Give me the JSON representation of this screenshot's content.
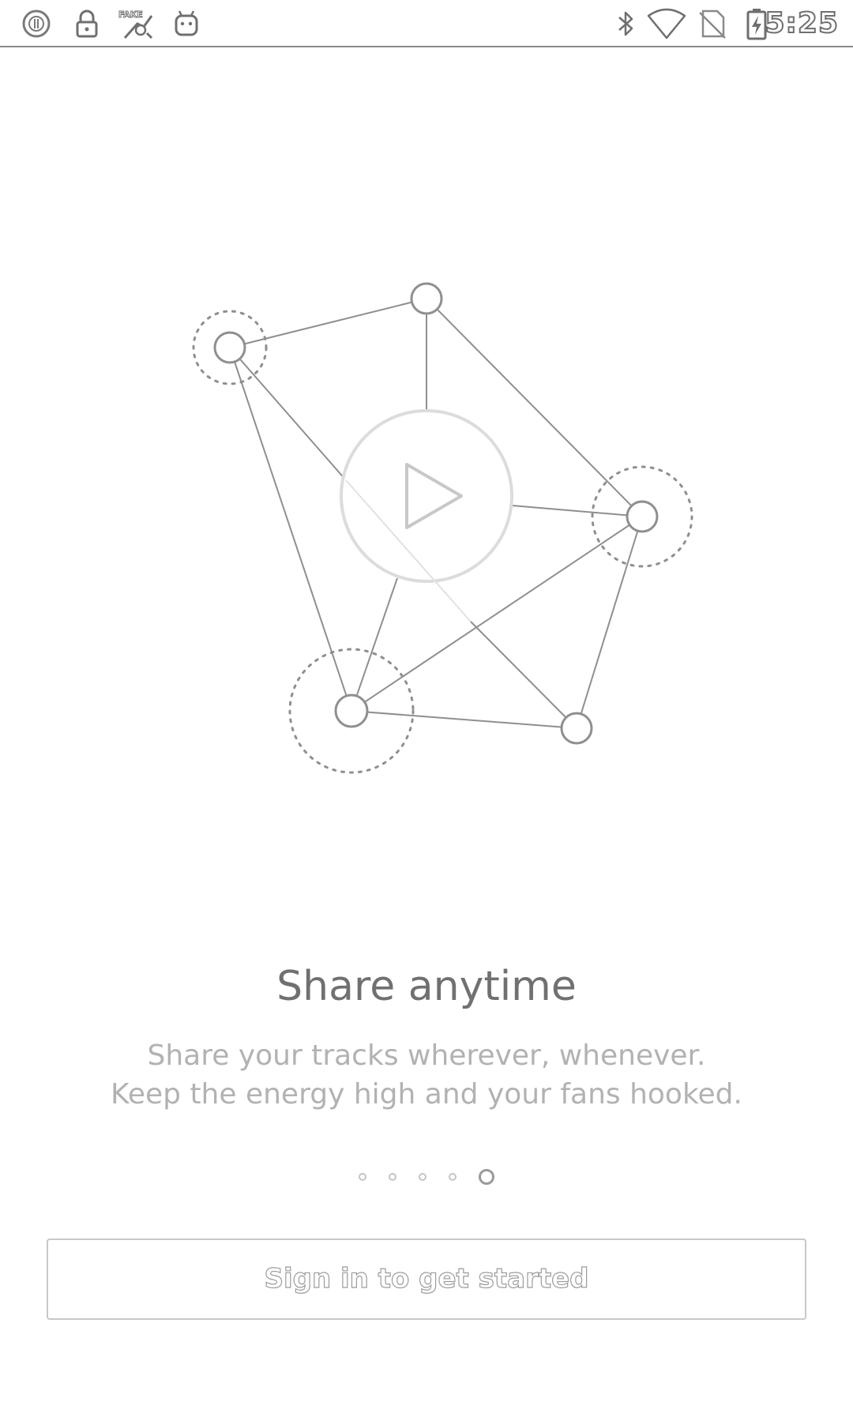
{
  "status_bar": {
    "time": "5:25",
    "left_icons": [
      "circle-notification-icon",
      "lock-icon",
      "fake-gps-icon",
      "android-icon"
    ],
    "right_icons": [
      "bluetooth-icon",
      "wifi-icon",
      "no-sim-icon",
      "battery-charging-icon"
    ]
  },
  "onboarding": {
    "title": "Share anytime",
    "subtitle_line1": "Share your tracks wherever, whenever.",
    "subtitle_line2": "Keep the energy high and your fans hooked.",
    "page_count": 5,
    "active_page": 5
  },
  "signin_button": {
    "label": "Sign in to get started"
  },
  "colors": {
    "background": "#ffffff",
    "line": "#8f8f8f",
    "title": "#707070",
    "subtitle": "#b2b2b2"
  }
}
